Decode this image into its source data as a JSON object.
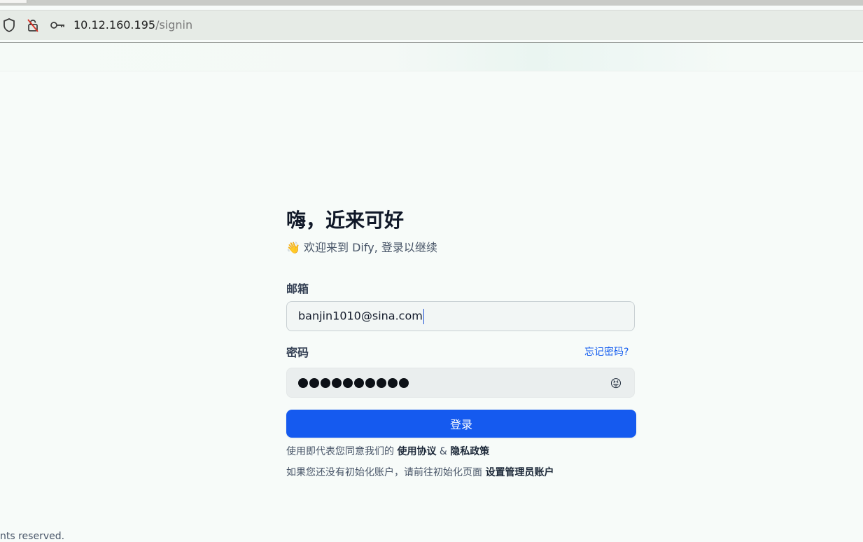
{
  "browser": {
    "url_host": "10.12.160.195",
    "url_path": "/signin",
    "icons": [
      "shield-icon",
      "no-lock-icon",
      "key-icon"
    ]
  },
  "page": {
    "title": "嗨，近来可好",
    "subtitle_emoji": "👋",
    "subtitle": "欢迎来到 Dify, 登录以继续",
    "email_label": "邮箱",
    "email_value": "banjin1010@sina.com",
    "password_label": "密码",
    "forgot_link": "忘记密码?",
    "password_masked_count": 10,
    "password_toggle_emoji": "😝",
    "submit_label": "登录",
    "terms_prefix": "使用即代表您同意我们的",
    "terms_link": "使用协议",
    "terms_amp": "&",
    "privacy_link": "隐私政策",
    "init_prefix": "如果您还没有初始化账户，请前往初始化页面",
    "init_link": "设置管理员账户",
    "footer": "nts reserved."
  },
  "colors": {
    "primary": "#155aef",
    "link": "#155eef",
    "page_bg": "#f7fbf9"
  }
}
